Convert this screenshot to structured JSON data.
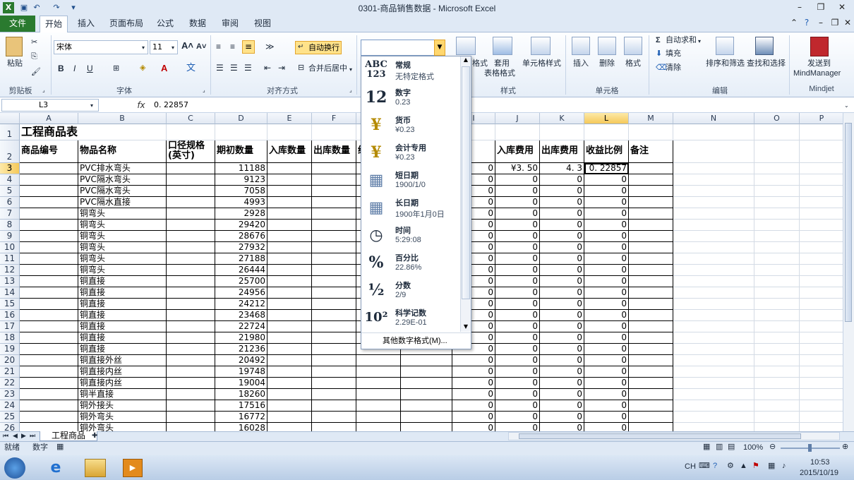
{
  "window": {
    "title": "0301-商品销售数据 - Microsoft Excel"
  },
  "tabs": [
    "文件",
    "开始",
    "插入",
    "页面布局",
    "公式",
    "数据",
    "审阅",
    "视图"
  ],
  "ribbon": {
    "clipboard": {
      "paste": "粘贴",
      "label": "剪贴板"
    },
    "font": {
      "name": "宋体",
      "size": "11",
      "label": "字体"
    },
    "alignment": {
      "wrap": "自动换行",
      "merge": "合并后居中",
      "label": "对齐方式"
    },
    "number": {
      "current": ""
    },
    "styles": {
      "cond": "格式",
      "table": "套用",
      "table2": "表格格式",
      "cell": "单元格样式",
      "label": "样式"
    },
    "cells": {
      "insert": "插入",
      "delete": "删除",
      "format": "格式",
      "label": "单元格"
    },
    "editing": {
      "autosum": "自动求和",
      "fill": "填充",
      "clear": "清除",
      "sort": "排序和筛选",
      "find": "查找和选择",
      "label": "编辑"
    },
    "mindjet": {
      "send1": "发送到",
      "send2": "MindManager",
      "label": "Mindjet"
    }
  },
  "formula": {
    "namebox": "L3",
    "fx": "fx",
    "value": "0. 22857"
  },
  "columns": [
    "A",
    "B",
    "C",
    "D",
    "E",
    "F",
    "G",
    "H",
    "I",
    "J",
    "K",
    "L",
    "M",
    "N",
    "O",
    "P"
  ],
  "sheet": {
    "title": "工程商品表",
    "headers": {
      "A": "商品编号",
      "B": "物品名称",
      "C1": "口径规格",
      "C2": "(英寸)",
      "D": "期初数量",
      "E": "入库数量",
      "F": "出库数量",
      "G": "结",
      "J": "入库费用",
      "K": "出库费用",
      "L": "收益比例",
      "M": "备注"
    },
    "rows": [
      {
        "n": "3",
        "b": "PVC排水弯头",
        "d": "11188",
        "i": "0",
        "j": "¥3. 50",
        "k": "4. 3",
        "l": "0. 22857"
      },
      {
        "n": "4",
        "b": "PVC隔水弯头",
        "d": "9123",
        "i": "0",
        "j": "0",
        "k": "0",
        "l": "0"
      },
      {
        "n": "5",
        "b": "PVC隔水弯头",
        "d": "7058",
        "i": "0",
        "j": "0",
        "k": "0",
        "l": "0"
      },
      {
        "n": "6",
        "b": "PVC隔水直接",
        "d": "4993",
        "i": "0",
        "j": "0",
        "k": "0",
        "l": "0"
      },
      {
        "n": "7",
        "b": "铜弯头",
        "d": "2928",
        "i": "0",
        "j": "0",
        "k": "0",
        "l": "0"
      },
      {
        "n": "8",
        "b": "铜弯头",
        "d": "29420",
        "i": "0",
        "j": "0",
        "k": "0",
        "l": "0"
      },
      {
        "n": "9",
        "b": "铜弯头",
        "d": "28676",
        "i": "0",
        "j": "0",
        "k": "0",
        "l": "0"
      },
      {
        "n": "10",
        "b": "铜弯头",
        "d": "27932",
        "i": "0",
        "j": "0",
        "k": "0",
        "l": "0"
      },
      {
        "n": "11",
        "b": "铜弯头",
        "d": "27188",
        "i": "0",
        "j": "0",
        "k": "0",
        "l": "0"
      },
      {
        "n": "12",
        "b": "铜弯头",
        "d": "26444",
        "i": "0",
        "j": "0",
        "k": "0",
        "l": "0"
      },
      {
        "n": "13",
        "b": "铜直接",
        "d": "25700",
        "i": "0",
        "j": "0",
        "k": "0",
        "l": "0"
      },
      {
        "n": "14",
        "b": "铜直接",
        "d": "24956",
        "i": "0",
        "j": "0",
        "k": "0",
        "l": "0"
      },
      {
        "n": "15",
        "b": "铜直接",
        "d": "24212",
        "i": "0",
        "j": "0",
        "k": "0",
        "l": "0"
      },
      {
        "n": "16",
        "b": "铜直接",
        "d": "23468",
        "i": "0",
        "j": "0",
        "k": "0",
        "l": "0"
      },
      {
        "n": "17",
        "b": "铜直接",
        "d": "22724",
        "i": "0",
        "j": "0",
        "k": "0",
        "l": "0"
      },
      {
        "n": "18",
        "b": "铜直接",
        "d": "21980",
        "i": "0",
        "j": "0",
        "k": "0",
        "l": "0"
      },
      {
        "n": "19",
        "b": "铜直接",
        "d": "21236",
        "i": "0",
        "j": "0",
        "k": "0",
        "l": "0"
      },
      {
        "n": "20",
        "b": "铜直接外丝",
        "d": "20492",
        "i": "0",
        "j": "0",
        "k": "0",
        "l": "0"
      },
      {
        "n": "21",
        "b": "铜直接内丝",
        "d": "19748",
        "i": "0",
        "j": "0",
        "k": "0",
        "l": "0"
      },
      {
        "n": "22",
        "b": "铜直接内丝",
        "d": "19004",
        "i": "0",
        "j": "0",
        "k": "0",
        "l": "0"
      },
      {
        "n": "23",
        "b": "铜半直接",
        "d": "18260",
        "i": "0",
        "j": "0",
        "k": "0",
        "l": "0"
      },
      {
        "n": "24",
        "b": "铜外接头",
        "d": "17516",
        "i": "0",
        "j": "0",
        "k": "0",
        "l": "0"
      },
      {
        "n": "25",
        "b": "铜外弯头",
        "d": "16772",
        "i": "0",
        "j": "0",
        "k": "0",
        "l": "0"
      },
      {
        "n": "26",
        "b": "铜外弯头",
        "d": "16028",
        "i": "0",
        "j": "0",
        "k": "0",
        "l": "0"
      }
    ]
  },
  "numberFormats": [
    {
      "icon": "ABC\n123",
      "name": "常规",
      "sample": "无特定格式"
    },
    {
      "icon": "12",
      "name": "数字",
      "sample": "0.23"
    },
    {
      "icon": "¥",
      "name": "货币",
      "sample": "¥0.23"
    },
    {
      "icon": "¥",
      "name": "会计专用",
      "sample": "¥0.23"
    },
    {
      "icon": "▦",
      "name": "短日期",
      "sample": "1900/1/0"
    },
    {
      "icon": "▦",
      "name": "长日期",
      "sample": "1900年1月0日"
    },
    {
      "icon": "◷",
      "name": "时间",
      "sample": "5:29:08"
    },
    {
      "icon": "%",
      "name": "百分比",
      "sample": "22.86%"
    },
    {
      "icon": "½",
      "name": "分数",
      "sample": "2/9"
    },
    {
      "icon": "10²",
      "name": "科学记数",
      "sample": "2.29E-01"
    }
  ],
  "moreFormats": "其他数字格式(M)...",
  "sheetTab": "工程商品",
  "status": {
    "ready": "就绪",
    "mode": "数字",
    "zoom": "100%"
  },
  "taskbar": {
    "ime": "CH",
    "time": "10:53",
    "date": "2015/10/19"
  }
}
